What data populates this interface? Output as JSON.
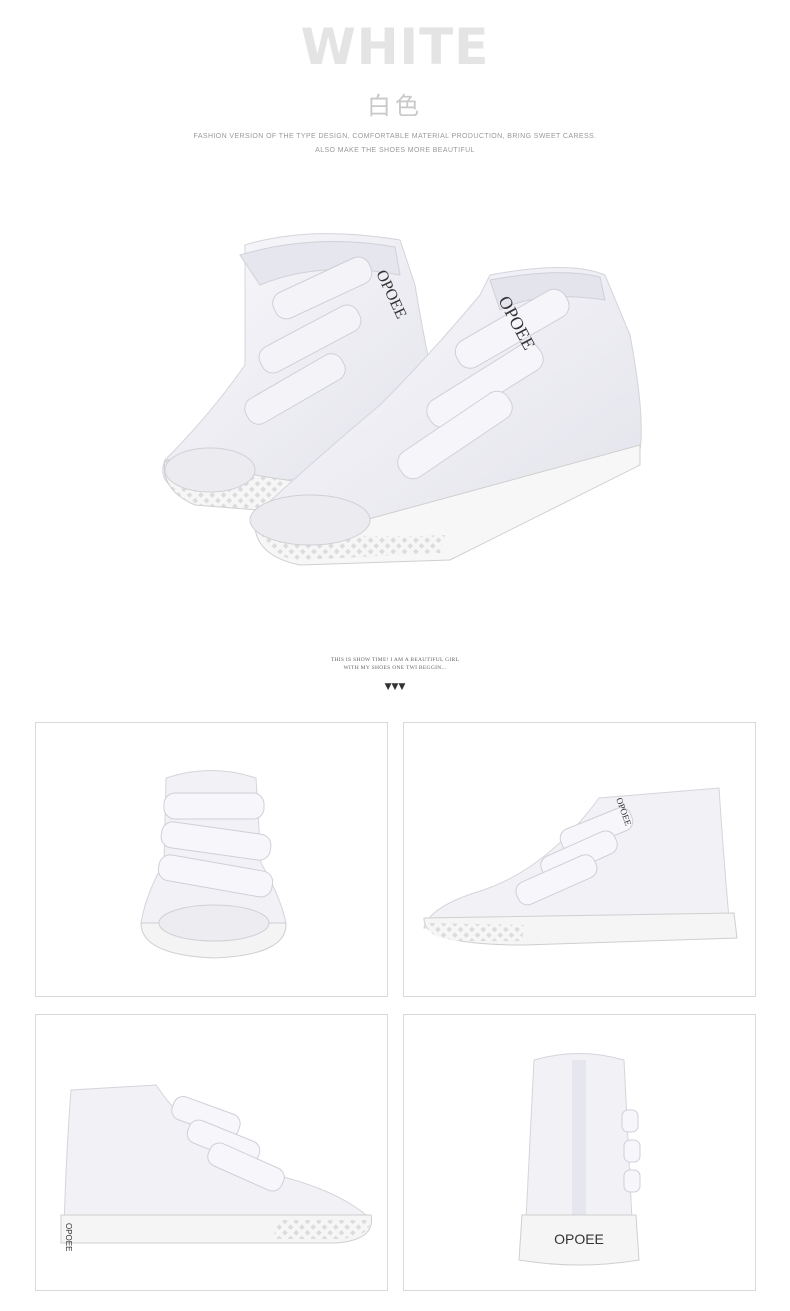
{
  "header": {
    "title": "WHITE",
    "subtitle_cn": "白色",
    "description_line1": "FASHION VERSION OF THE TYPE DESIGN, COMFORTABLE MATERIAL PRODUCTION, BRING SWEET CARESS.",
    "description_line2": "ALSO MAKE THE SHOES MORE BEAUTIFUL"
  },
  "hero": {
    "image": "white-velcro-high-top-sneakers-pair",
    "brand_text": "OPOEE"
  },
  "caption": {
    "line1": "THIS IS SHOW TIME! I AM A BEAUTIFUL GIRL",
    "line2": "WITH MY SHOES ONE TWI BEGGIN...",
    "arrows": "▼▼▼"
  },
  "gallery": [
    {
      "view": "front-view",
      "image": "white-sneaker-front"
    },
    {
      "view": "side-view-right",
      "image": "white-sneaker-side-right"
    },
    {
      "view": "side-view-left",
      "image": "white-sneaker-side-left"
    },
    {
      "view": "back-view",
      "image": "white-sneaker-back",
      "heel_label": "OPOEE"
    }
  ],
  "colors": {
    "title": "#e4e4e4",
    "canvas": "#ffffff",
    "shoe_body": "#f1f1f6",
    "shoe_shadow": "#d8d8e0",
    "sole": "#f7f7f7",
    "border": "#d9d9d9"
  }
}
